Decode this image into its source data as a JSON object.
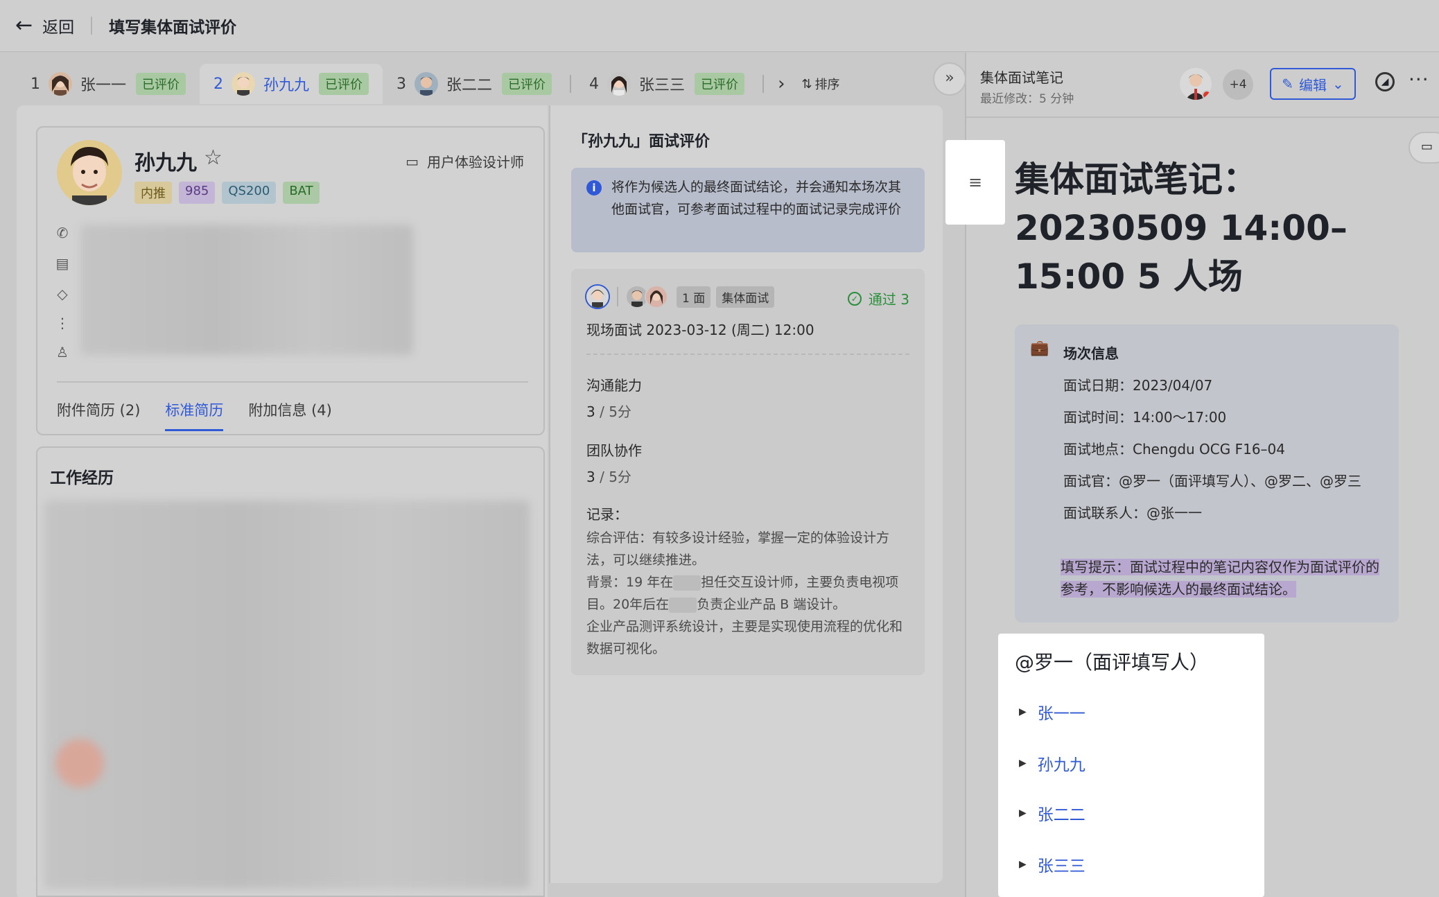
{
  "header": {
    "back_label": "返回",
    "title": "填写集体面试评价"
  },
  "candidate_tabs": [
    {
      "num": "1",
      "name": "张一一",
      "status": "已评价"
    },
    {
      "num": "2",
      "name": "孙九九",
      "status": "已评价"
    },
    {
      "num": "3",
      "name": "张二二",
      "status": "已评价"
    },
    {
      "num": "4",
      "name": "张三三",
      "status": "已评价"
    }
  ],
  "sort_label": "排序",
  "profile": {
    "name": "孙九九",
    "job": "用户体验设计师",
    "tags": [
      "内推",
      "985",
      "QS200",
      "BAT"
    ],
    "resume_tabs": [
      "附件简历 (2)",
      "标准简历",
      "附加信息 (4)"
    ]
  },
  "work_title": "工作经历",
  "evaluation": {
    "title": "「孙九九」面试评价",
    "notice": "将作为候选人的最终面试结论，并会通知本场次其他面试官，可参考面试过程中的面试记录完成评价",
    "round_tag": "1 面",
    "type_tag": "集体面试",
    "pass_label": "通过 3",
    "time": "现场面试 2023-03-12 (周二) 12:00",
    "scores": [
      {
        "label": "沟通能力",
        "value": "3",
        "max": " / 5分"
      },
      {
        "label": "团队协作",
        "value": "3",
        "max": " / 5分"
      }
    ],
    "note_label": "记录：",
    "note_line1": "综合评估：有较多设计经验，掌握一定的体验设计方法，可以继续推进。",
    "note_line2a": "背景：19 年在",
    "note_line2b": "担任交互设计师，主要负责电视项目。20年后在",
    "note_line2c": "负责企业产品 B 端设计。",
    "note_line3": "企业产品测评系统设计，主要是实现使用流程的优化和数据可视化。"
  },
  "doc": {
    "name": "集体面试笔记",
    "modified": "最近修改：5 分钟",
    "more_users": "+4",
    "edit_label": "编辑",
    "title": "集体面试笔记：20230509 14:00–15:00 5 人场",
    "info_head": "场次信息",
    "info_lines": [
      "面试日期：2023/04/07",
      "面试时间：14:00～17:00",
      "面试地点：Chengdu OCG F16–04",
      "面试官：@罗一（面评填写人）、@罗二、@罗三",
      "面试联系人：@张一一"
    ],
    "hint": "填写提示：面试过程中的笔记内容仅作为面试评价的参考，不影响候选人的最终面试结论。",
    "list_heading": "@罗一（面评填写人）",
    "list_items": [
      "张一一",
      "孙九九",
      "张二二",
      "张三三"
    ]
  }
}
